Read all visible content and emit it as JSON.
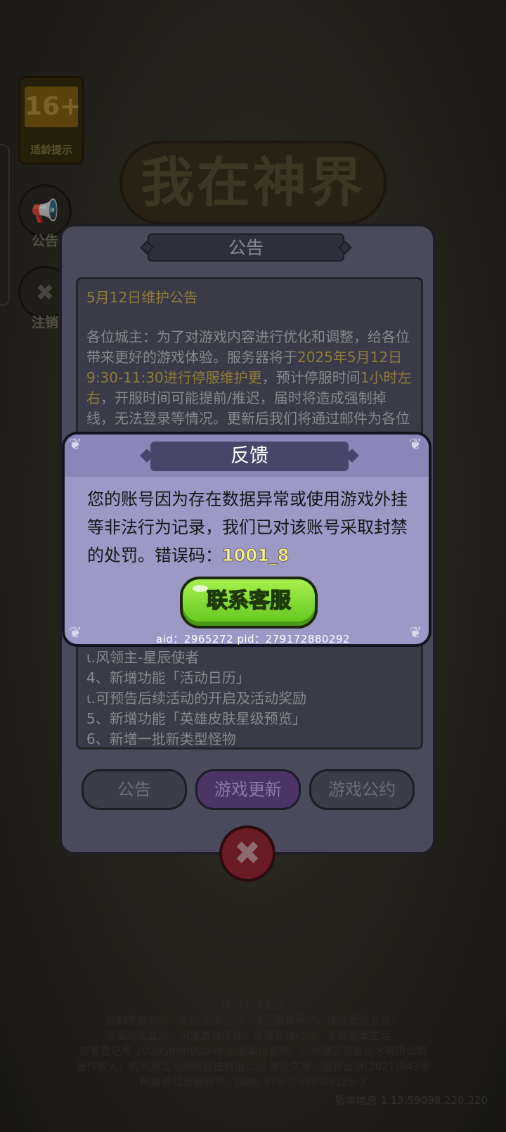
{
  "background": {
    "age_rating": {
      "number": "16+",
      "caption": "适龄提示"
    },
    "game_logo": "我在神界",
    "side_buttons": [
      {
        "label": "公告",
        "icon": "megaphone-icon"
      },
      {
        "label": "注销",
        "icon": "logout-icon"
      }
    ],
    "footer": {
      "lines": [
        "健康游戏忠告",
        "抵制不良游戏，拒绝盗版游戏。注意自我保护，谨防受骗上当。",
        "适度游戏益脑，沉迷游戏伤身。合理安排时间，享受健康生活。",
        "软著登记号:2020SR0000000 出版单位名称：广州盈正信息技术有限公司",
        "著作权人：杭州风之力网络科技有限公司 审批文号：国新出审[2021]943号",
        "网络游戏出版物号：ISBN 978-7-498-09125-3"
      ],
      "version": "版本信息 1.13.59098.220.220"
    }
  },
  "notice": {
    "title": "公告",
    "body_title": "5月12日维护公告",
    "para_a": "各位城主：为了对游戏内容进行优化和调整，给各位带来更好的游戏体验。服务器将于",
    "para_hl1": "2025年5月12日9:30-11:30进行停服维护更",
    "para_b": "，预计停服时间",
    "para_hl2": "1小时左右",
    "para_c": "，开服时间可能提前/推迟，届时将造成强制掉线，无法登录等情况。",
    "para_d": "更新后我们将通过邮件为各位发放以下维护补偿。",
    "list": [
      "ι.风领主-星辰使者",
      "4、新增功能「活动日历」",
      "ι.可预告后续活动的开启及活动奖励",
      "5、新增功能「英雄皮肤星级预览」",
      "6、新增一批新类型怪物"
    ],
    "tabs": [
      "公告",
      "游戏更新",
      "游戏公约"
    ],
    "active_tab": "游戏更新"
  },
  "feedback": {
    "title": "反馈",
    "message": "您的账号因为存在数据异常或使用游戏外挂等非法行为记录，我们已对该账号采取封禁的处罚。错误码：",
    "error_code": "1001_8",
    "button_label": "联系客服",
    "ids": "aid：2965272 pid：279172880292"
  },
  "colors": {
    "accent_green": "#7ed63a",
    "dialog_purple": "#9c99c6",
    "error_code_yellow": "#f7ee8a"
  }
}
